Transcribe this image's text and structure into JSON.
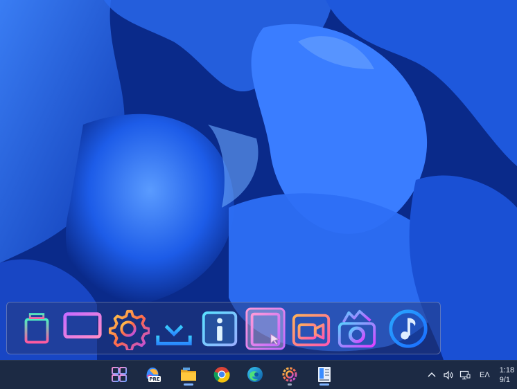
{
  "dock": {
    "items": [
      {
        "name": "recycle-bin",
        "icon": "trash-icon"
      },
      {
        "name": "this-pc",
        "icon": "monitor-icon"
      },
      {
        "name": "settings",
        "icon": "gear-icon"
      },
      {
        "name": "downloads",
        "icon": "download-icon"
      },
      {
        "name": "info",
        "icon": "info-icon"
      },
      {
        "name": "documents",
        "icon": "document-icon"
      },
      {
        "name": "videos",
        "icon": "video-camera-icon"
      },
      {
        "name": "pictures",
        "icon": "photo-camera-icon"
      },
      {
        "name": "music",
        "icon": "music-note-icon"
      }
    ]
  },
  "taskbar": {
    "items": [
      {
        "name": "start",
        "icon": "windows-start-icon"
      },
      {
        "name": "copilot-pre",
        "icon": "copilot-icon",
        "badge": "PRE"
      },
      {
        "name": "file-explorer",
        "icon": "folder-icon"
      },
      {
        "name": "chrome",
        "icon": "chrome-icon"
      },
      {
        "name": "edge",
        "icon": "edge-icon"
      },
      {
        "name": "settings",
        "icon": "gear-icon"
      },
      {
        "name": "app",
        "icon": "panel-app-icon"
      }
    ],
    "tray": {
      "language": "ΕΛ",
      "time": "1:18",
      "date": "9/1"
    }
  },
  "colors": {
    "accent": "#7fb4ff",
    "taskbar": "#1c2a44"
  }
}
